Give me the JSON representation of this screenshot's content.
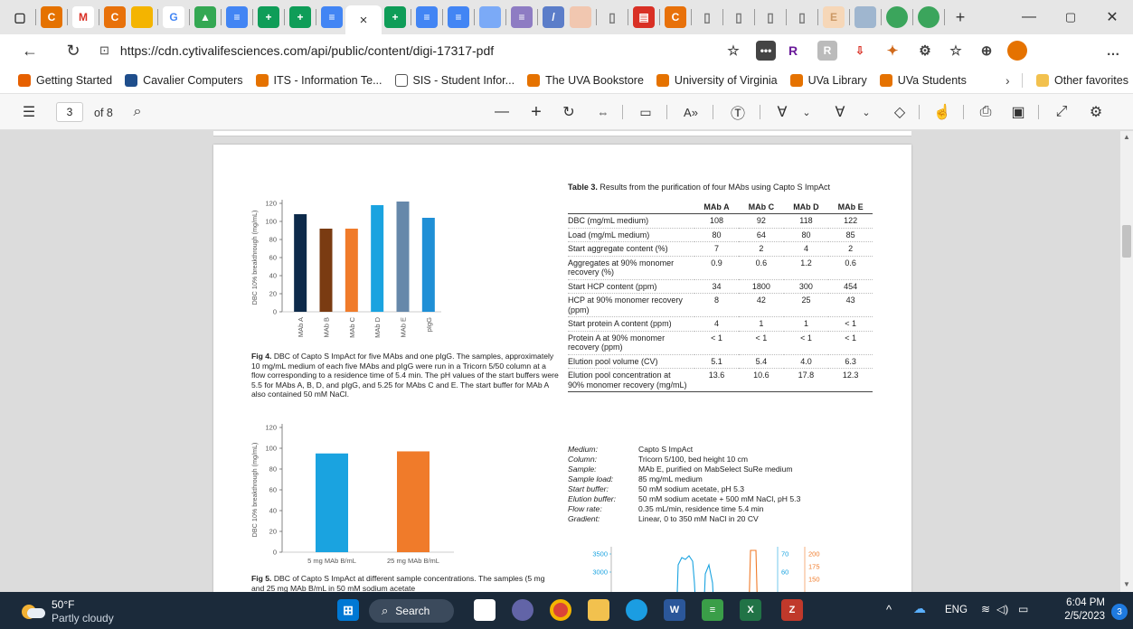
{
  "browser": {
    "tab_close_glyph": "×",
    "new_tab_glyph": "+",
    "url": "https://cdn.cytivalifesciences.com/api/public/content/digi-17317-pdf"
  },
  "favorites": {
    "items": [
      {
        "label": "Getting Started",
        "color": "#e66000"
      },
      {
        "label": "Cavalier Computers",
        "color": "#1f4e8c"
      },
      {
        "label": "ITS - Information Te...",
        "color": "#e57200"
      },
      {
        "label": "SIS - Student Infor...",
        "color": "#ffffff"
      },
      {
        "label": "The UVA Bookstore",
        "color": "#e57200"
      },
      {
        "label": "University of Virginia",
        "color": "#e57200"
      },
      {
        "label": "UVa Library",
        "color": "#e57200"
      },
      {
        "label": "UVa Students",
        "color": "#e57200"
      }
    ],
    "other": "Other favorites"
  },
  "pdf_toolbar": {
    "page_current": "3",
    "page_total": "of 8"
  },
  "figure4": {
    "caption_label": "Fig 4.",
    "caption_text": "DBC of Capto S ImpAct for five MAbs and one pIgG. The samples, approximately 10 mg/mL medium of each five MAbs and pIgG were run in a Tricorn 5/50 column at a flow corresponding to a residence time of 5.4 min. The pH values of the start buffers were 5.5 for MAbs A, B, D, and pIgG, and 5.25 for MAbs C and E. The start buffer for MAb A also contained 50 mM NaCl."
  },
  "figure5": {
    "caption_label": "Fig 5.",
    "caption_text": "DBC of Capto S ImpAct at different sample concentrations. The samples (5 mg and 25 mg MAb B/mL in 50 mM sodium acetate"
  },
  "chart_data": [
    {
      "type": "bar",
      "ylabel": "DBC 10% breakthrough (mg/mL)",
      "ylim": [
        0,
        120
      ],
      "yticks": [
        0,
        20,
        40,
        60,
        80,
        100,
        120
      ],
      "categories": [
        "MAb A",
        "MAb B",
        "MAb C",
        "MAb D",
        "MAb E",
        "pIgG"
      ],
      "values": [
        108,
        92,
        92,
        118,
        122,
        104
      ],
      "colors": [
        "#0d2a4a",
        "#7a3b12",
        "#f07b2a",
        "#1aa3e0",
        "#6688aa",
        "#1f8fd6"
      ]
    },
    {
      "type": "bar",
      "ylabel": "DBC 10% breakthrough (mg/mL)",
      "ylim": [
        0,
        120
      ],
      "yticks": [
        0,
        20,
        40,
        60,
        80,
        100,
        120
      ],
      "categories": [
        "5 mg MAb B/mL",
        "25 mg MAb B/mL"
      ],
      "values": [
        95,
        97
      ],
      "colors": [
        "#1aa3e0",
        "#f07b2a"
      ]
    },
    {
      "type": "line",
      "yticks_left": [
        3500,
        3000
      ],
      "yticks_mid": [
        70,
        60
      ],
      "yticks_right": [
        200,
        175,
        150
      ],
      "left_color": "#1aa3e0",
      "mid_color": "#1aa3e0",
      "right_color": "#f07b2a"
    }
  ],
  "table3": {
    "title_label": "Table 3.",
    "title_text": "Results from the purification of four MAbs using Capto S ImpAct",
    "headers": [
      "",
      "MAb A",
      "MAb C",
      "MAb D",
      "MAb E"
    ],
    "rows": [
      [
        "DBC (mg/mL medium)",
        "108",
        "92",
        "118",
        "122"
      ],
      [
        "Load (mg/mL medium)",
        "80",
        "64",
        "80",
        "85"
      ],
      [
        "Start aggregate content (%)",
        "7",
        "2",
        "4",
        "2"
      ],
      [
        "Aggregates at 90% monomer recovery (%)",
        "0.9",
        "0.6",
        "1.2",
        "0.6"
      ],
      [
        "Start HCP content (ppm)",
        "34",
        "1800",
        "300",
        "454"
      ],
      [
        "HCP at 90% monomer recovery (ppm)",
        "8",
        "42",
        "25",
        "43"
      ],
      [
        "Start protein A content (ppm)",
        "4",
        "1",
        "1",
        "< 1"
      ],
      [
        "Protein A at 90% monomer recovery (ppm)",
        "< 1",
        "< 1",
        "< 1",
        "< 1"
      ],
      [
        "Elution pool volume (CV)",
        "5.1",
        "5.4",
        "4.0",
        "6.3"
      ],
      [
        "Elution pool concentration at 90% monomer recovery (mg/mL)",
        "13.6",
        "10.6",
        "17.8",
        "12.3"
      ]
    ]
  },
  "conditions": [
    {
      "k": "Medium:",
      "v": "Capto S ImpAct"
    },
    {
      "k": "Column:",
      "v": "Tricorn 5/100, bed height 10 cm"
    },
    {
      "k": "Sample:",
      "v": "MAb E, purified on MabSelect SuRe medium"
    },
    {
      "k": "Sample load:",
      "v": "85 mg/mL medium"
    },
    {
      "k": "Start buffer:",
      "v": "50 mM sodium acetate, pH 5.3"
    },
    {
      "k": "Elution buffer:",
      "v": "50 mM sodium acetate + 500 mM NaCl, pH 5.3"
    },
    {
      "k": "Flow rate:",
      "v": "0.35 mL/min, residence time 5.4 min"
    },
    {
      "k": "Gradient:",
      "v": "Linear, 0 to 350 mM NaCl in 20 CV"
    }
  ],
  "taskbar": {
    "temp": "50°F",
    "weather": "Partly cloudy",
    "search": "Search",
    "lang": "ENG",
    "time": "6:04 PM",
    "date": "2/5/2023",
    "badge": "3"
  }
}
